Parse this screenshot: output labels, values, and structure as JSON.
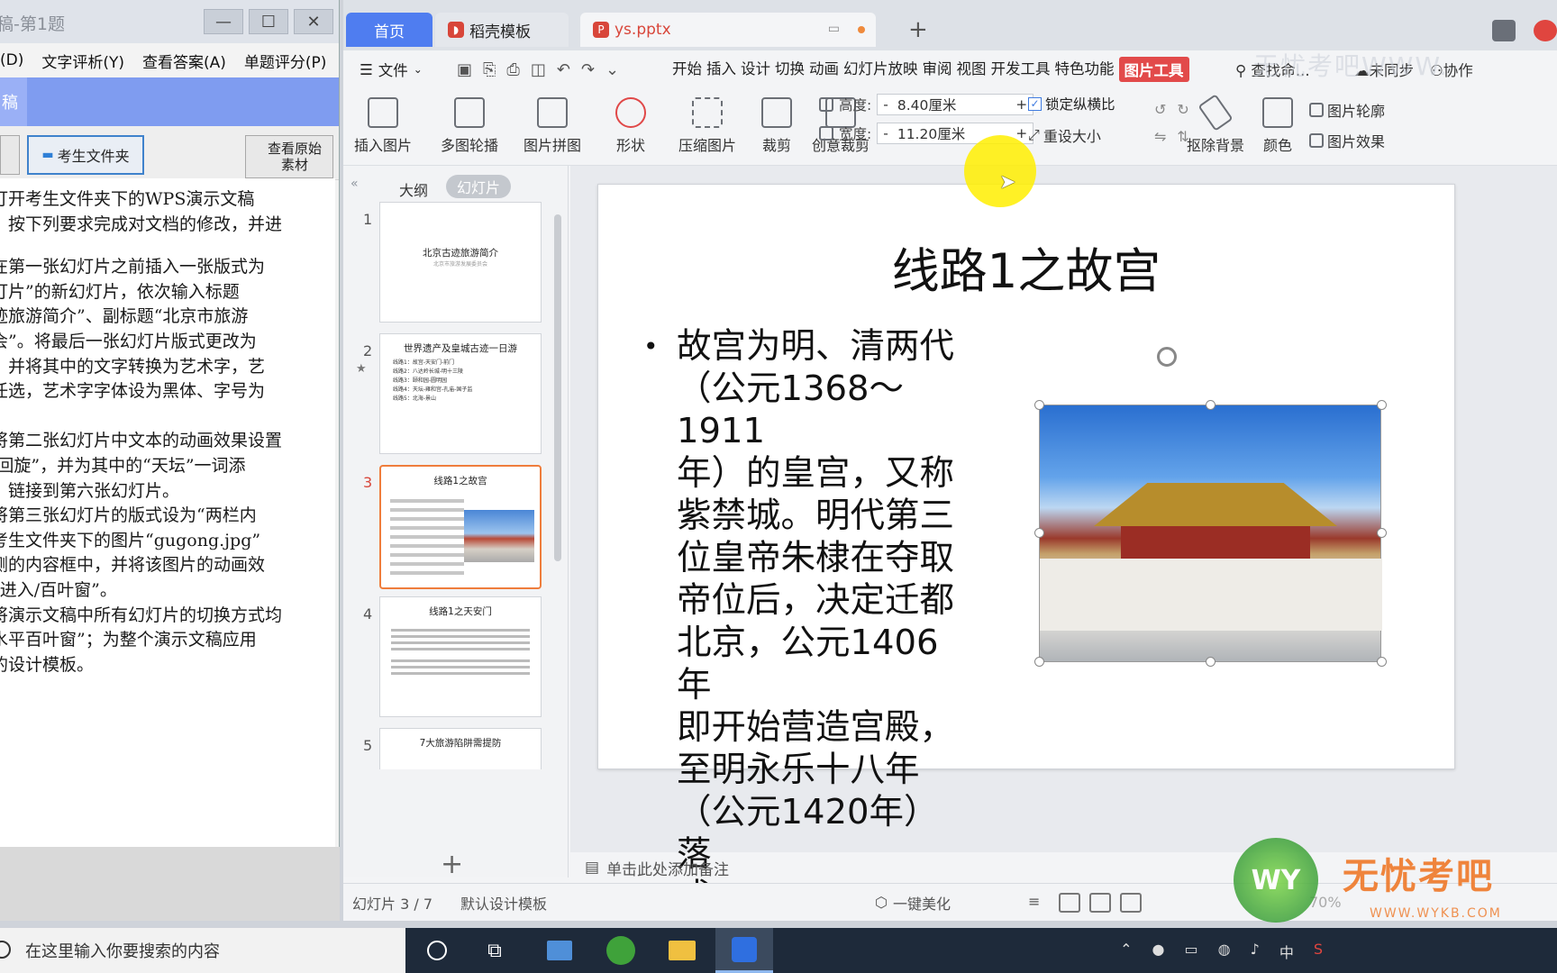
{
  "exam": {
    "title": "稿-第1题",
    "menus": [
      "(D)",
      "文字评析(Y)",
      "查看答案(A)",
      "单题评分(P)"
    ],
    "banner_badge": "稿",
    "folder_button": "考生文件夹",
    "original_button": "查看原始素材",
    "instructions": [
      "打开考生文件夹下的WPS演示文稿",
      "，按下列要求完成对文档的修改，并进",
      "",
      "在第一张幻灯片之前插入一张版式为",
      "灯片”的新幻灯片，依次输入标题",
      "迹旅游简介”、副标题“北京市旅游",
      "会”。将最后一张幻灯片版式更改为",
      "，并将其中的文字转换为艺术字，艺",
      "任选，艺术字字体设为黑体、字号为",
      "。",
      "将第二张幻灯片中文本的动画效果设置",
      "/回旋”，并为其中的“天坛”一词添",
      "，链接到第六张幻灯片。",
      "将第三张幻灯片的版式设为“两栏内",
      "考生文件夹下的图片“gugong.jpg”",
      "侧的内容框中，并将该图片的动画效",
      "“进入/百叶窗”。",
      "将演示文稿中所有幻灯片的切换方式均",
      "水平百叶窗”；为整个演示文稿应用",
      "的设计模板。"
    ]
  },
  "wps": {
    "tabs": {
      "home": "首页",
      "template": "稻壳模板",
      "document": "ys.pptx"
    },
    "file_menu": "文件",
    "menus": [
      "开始",
      "插入",
      "设计",
      "切换",
      "动画",
      "幻灯片放映",
      "审阅",
      "视图",
      "开发工具",
      "特色功能"
    ],
    "active_menu": "图片工具",
    "search": "查找命...",
    "sync": "未同步",
    "collab": "协作",
    "watermark": "无忧考吧WWW.",
    "ribbon": {
      "insert_pic": "插入图片",
      "multi_carousel": "多图轮播",
      "pic_collage": "图片拼图",
      "shape": "形状",
      "compress": "压缩图片",
      "crop": "裁剪",
      "creative_crop": "创意裁剪",
      "height_label": "高度:",
      "height_value": "8.40厘米",
      "width_label": "宽度:",
      "width_value": "11.20厘米",
      "lock_ratio": "锁定纵横比",
      "reset_size": "重设大小",
      "remove_bg": "抠除背景",
      "color": "颜色",
      "outline": "图片轮廓",
      "effect": "图片效果"
    },
    "panel": {
      "outline_tab": "大纲",
      "slides_tab": "幻灯片"
    },
    "thumbnails": [
      {
        "num": "1",
        "title": "北京古迹旅游简介",
        "sub": "北京市旅游发展委员会"
      },
      {
        "num": "2",
        "title": "世界遗产及皇城古迹一日游",
        "lines": [
          "线路1：故宫-天安门-前门",
          "线路2：八达岭长城-明十三陵",
          "线路3：颐和园-圆明园",
          "线路4：天坛-雍和宫-孔庙-国子监",
          "线路5：北海-景山"
        ]
      },
      {
        "num": "3",
        "title": "线路1之故宫"
      },
      {
        "num": "4",
        "title": "线路1之天安门"
      },
      {
        "num": "5",
        "title": "7大旅游陷阱需提防"
      }
    ],
    "slide": {
      "title": "线路1之故宫",
      "bullet": "•",
      "body_lines": [
        "故宫为明、清两代",
        "（公元1368～1911",
        "年）的皇宫，又称",
        "紫禁城。明代第三",
        "位皇帝朱棣在夺取",
        "帝位后，决定迁都",
        "北京，公元1406年",
        "即开始营造宫殿，",
        "至明永乐十八年",
        "（公元1420年）落",
        "成。"
      ]
    },
    "notes_placeholder": "单击此处添加备注",
    "status": {
      "slide_num": "幻灯片 3 / 7",
      "template": "默认设计模板",
      "beautify": "一键美化",
      "zoom": "70%"
    }
  },
  "taskbar": {
    "search_placeholder": "在这里输入你要搜索的内容",
    "ime": "中"
  },
  "branding": {
    "wy": "WY",
    "brand": "无忧考吧",
    "url": "WWW.WYKB.COM"
  }
}
